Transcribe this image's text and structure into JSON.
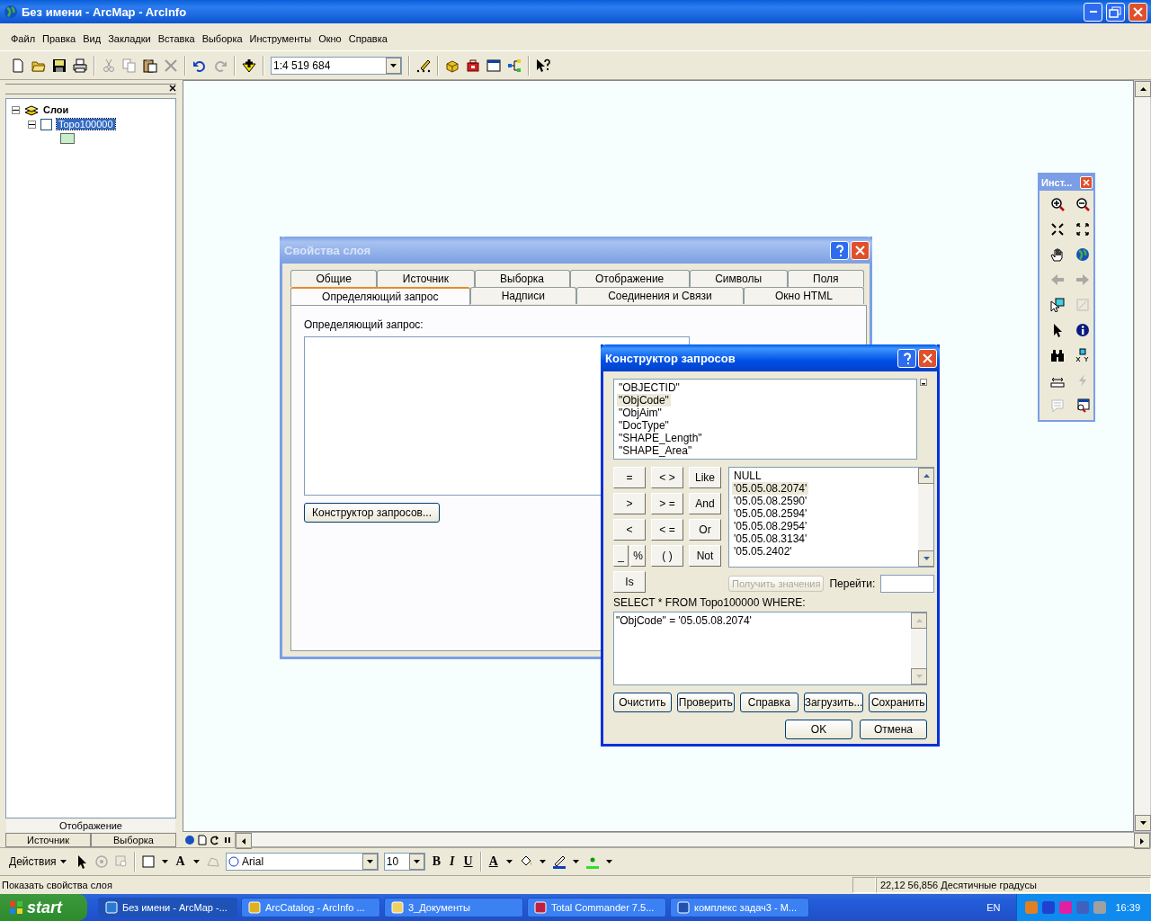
{
  "window": {
    "title": "Без имени - ArcMap - ArcInfo"
  },
  "menu": [
    "Файл",
    "Правка",
    "Вид",
    "Закладки",
    "Вставка",
    "Выборка",
    "Инструменты",
    "Окно",
    "Справка"
  ],
  "toolbar": {
    "scale": "1:4 519 684"
  },
  "toc": {
    "tree": {
      "label": "Слои",
      "expanded": true,
      "children": [
        {
          "label": "Topo100000",
          "checked": false,
          "selected": true,
          "expanded": true
        }
      ]
    },
    "tabs": [
      {
        "label": "Отображение",
        "selected": true
      },
      {
        "label": "Источник",
        "selected": false
      },
      {
        "label": "Выборка",
        "selected": false
      }
    ]
  },
  "tools_palette": {
    "title": "Инст..."
  },
  "layer_properties": {
    "title": "Свойства слоя",
    "tabs_row1": [
      {
        "label": "Общие",
        "selected": false
      },
      {
        "label": "Источник",
        "selected": false
      },
      {
        "label": "Выборка",
        "selected": false
      },
      {
        "label": "Отображение",
        "selected": false
      },
      {
        "label": "Символы",
        "selected": false
      },
      {
        "label": "Поля",
        "selected": false
      }
    ],
    "tabs_row2": [
      {
        "label": "Определяющий запрос",
        "selected": true
      },
      {
        "label": "Надписи",
        "selected": false
      },
      {
        "label": "Соединения и Связи",
        "selected": false
      },
      {
        "label": "Окно HTML",
        "selected": false
      }
    ],
    "query_label": "Определяющий запрос:",
    "builder_button": "Конструктор запросов..."
  },
  "query_builder": {
    "title": "Конструктор запросов",
    "fields": [
      {
        "label": "\"OBJECTID\"",
        "selected": false
      },
      {
        "label": "\"ObjCode\"",
        "selected": true
      },
      {
        "label": "\"ObjAim\"",
        "selected": false
      },
      {
        "label": "\"DocType\"",
        "selected": false
      },
      {
        "label": "\"SHAPE_Length\"",
        "selected": false
      },
      {
        "label": "\"SHAPE_Area\"",
        "selected": false
      }
    ],
    "operators": [
      "=",
      "< >",
      "Like",
      ">",
      "> =",
      "And",
      "<",
      "< =",
      "Or",
      "_",
      "%",
      "( )",
      "Not",
      "Is"
    ],
    "values": [
      {
        "label": "NULL",
        "selected": false
      },
      {
        "label": "'05.05.08.2074'",
        "selected": true
      },
      {
        "label": "'05.05.08.2590'",
        "selected": false
      },
      {
        "label": "'05.05.08.2594'",
        "selected": false
      },
      {
        "label": "'05.05.08.2954'",
        "selected": false
      },
      {
        "label": "'05.05.08.3134'",
        "selected": false
      },
      {
        "label": "'05.05.2402'",
        "selected": false
      }
    ],
    "get_values": {
      "label": "Получить значения",
      "disabled": true
    },
    "goto_label": "Перейти:",
    "sql_label": "SELECT * FROM Topo100000 WHERE:",
    "expression": "\"ObjCode\" = '05.05.08.2074'",
    "buttons": [
      "Очистить",
      "Проверить",
      "Справка",
      "Загрузить...",
      "Сохранить"
    ],
    "ok": "OK",
    "cancel": "Отмена"
  },
  "draw_toolbar": {
    "actions": "Действия",
    "text_tool": "A",
    "font": "Arial",
    "size": "10",
    "format": [
      "B",
      "I",
      "U"
    ],
    "font_color": "A"
  },
  "status_bar": {
    "message": "Показать свойства слоя",
    "coords": "22,12  56,856 Десятичные градусы"
  },
  "taskbar": {
    "start": "start",
    "tasks": [
      {
        "label": "Без имени - ArcMap -...",
        "selected": true
      },
      {
        "label": "ArcCatalog - ArcInfo ...",
        "selected": false
      },
      {
        "label": "3_Документы",
        "selected": false
      },
      {
        "label": "Total Commander 7.5...",
        "selected": false
      },
      {
        "label": "комплекс задач3 - M...",
        "selected": false
      }
    ],
    "lang": "EN",
    "clock": "16:39"
  }
}
